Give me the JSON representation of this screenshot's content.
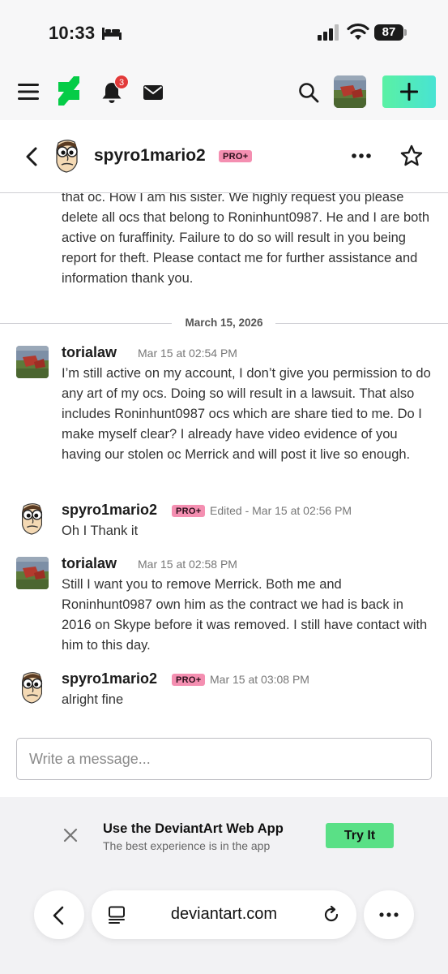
{
  "status_bar": {
    "time": "10:33",
    "battery": "87",
    "icons": [
      "bed-icon",
      "signal-icon",
      "wifi-icon",
      "battery-icon"
    ]
  },
  "nav": {
    "notification_count": "3",
    "icons": [
      "hamburger-icon",
      "deviantart-logo-icon",
      "bell-icon",
      "mail-icon",
      "search-icon",
      "plus-icon"
    ],
    "accent_gradient": [
      "#5af1a4",
      "#48e3d3"
    ]
  },
  "conversation": {
    "username": "spyro1mario2",
    "badge": "PRO+",
    "badge_color": "#f48fb1"
  },
  "thread": {
    "partial_message": "that oc. How I am his sister. We highly request you please delete all ocs that belong to Roninhunt0987. He and I are both active on furaffinity. Failure to do so will result in you being report for theft. Please contact me for further assistance and information thank you.",
    "date_separator": "March 15, 2026",
    "messages": [
      {
        "author": "torialaw",
        "meta": "Mar 15 at 02:54 PM",
        "pro": "",
        "text": "I’m still active on my account, I don’t give you permission to do any art of my ocs. Doing so will result in a lawsuit. That also includes Roninhunt0987 ocs which are share tied to me. Do I make myself clear? I already have video evidence of you having our stolen oc Merrick and will post it live so enough."
      },
      {
        "author": "spyro1mario2",
        "meta": "Edited - Mar 15 at 02:56 PM",
        "pro": "PRO+",
        "text": "Oh I Thank it"
      },
      {
        "author": "torialaw",
        "meta": "Mar 15 at 02:58 PM",
        "pro": "",
        "text": "Still I want you to remove Merrick. Both me and Roninhunt0987 own him as the contract we had is back in 2016 on Skype before it was removed. I still have contact with him to this day."
      },
      {
        "author": "spyro1mario2",
        "meta": "Mar 15 at 03:08 PM",
        "pro": "PRO+",
        "text": "alright fine"
      }
    ]
  },
  "compose": {
    "placeholder": "Write a message...",
    "value": ""
  },
  "app_banner": {
    "title": "Use the DeviantArt Web App",
    "subtitle": "The best experience is in the app",
    "button": "Try It",
    "button_color": "#5ae086"
  },
  "browser": {
    "url": "deviantart.com",
    "icons": [
      "back-icon",
      "reader-icon",
      "reload-icon",
      "more-icon"
    ]
  }
}
